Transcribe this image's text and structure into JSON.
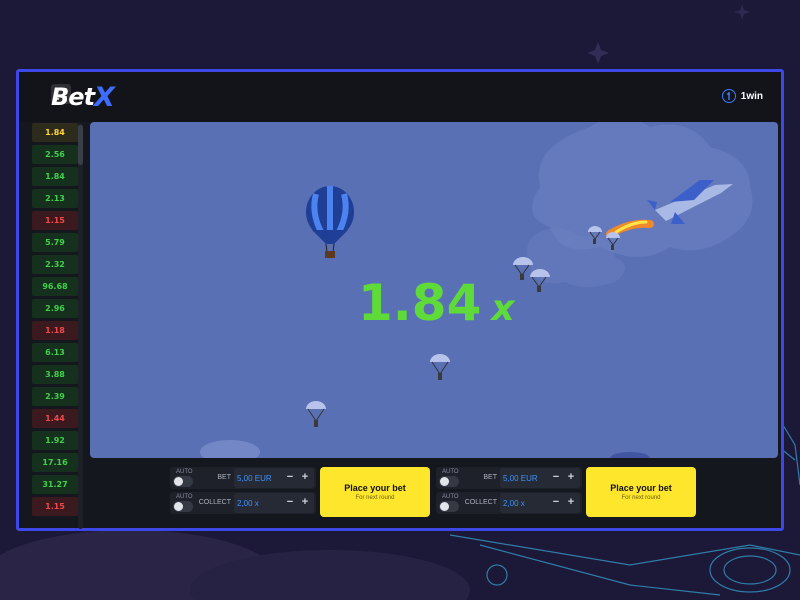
{
  "header": {
    "logo_main": "Bet",
    "logo_accent": "X",
    "brand": "1win",
    "fullscreen_icon": "fullscreen-icon",
    "brand_icon": "1win-coin-icon"
  },
  "history": [
    {
      "value": "1.84",
      "tone": "gold"
    },
    {
      "value": "2.56",
      "tone": "green"
    },
    {
      "value": "1.84",
      "tone": "green"
    },
    {
      "value": "2.13",
      "tone": "green"
    },
    {
      "value": "1.15",
      "tone": "red"
    },
    {
      "value": "5.79",
      "tone": "green"
    },
    {
      "value": "2.32",
      "tone": "green"
    },
    {
      "value": "96.68",
      "tone": "green"
    },
    {
      "value": "2.96",
      "tone": "green"
    },
    {
      "value": "1.18",
      "tone": "red"
    },
    {
      "value": "6.13",
      "tone": "green"
    },
    {
      "value": "3.88",
      "tone": "green"
    },
    {
      "value": "2.39",
      "tone": "green"
    },
    {
      "value": "1.44",
      "tone": "red"
    },
    {
      "value": "1.92",
      "tone": "green"
    },
    {
      "value": "17.16",
      "tone": "green"
    },
    {
      "value": "31.27",
      "tone": "green"
    },
    {
      "value": "1.15",
      "tone": "red"
    }
  ],
  "game": {
    "multiplier": "1.84",
    "multiplier_suffix": "x"
  },
  "colors": {
    "accent": "#3d48e6",
    "multiplier": "#5fdb39",
    "bet_button": "#fde62c",
    "sky": "#5a70b5"
  },
  "bet_panels": [
    {
      "auto_label_1": "AUTO",
      "auto_label_2": "AUTO",
      "bet_label": "BET",
      "bet_value": "5,00 EUR",
      "collect_label": "COLLECT",
      "collect_value": "2,00 x",
      "button_title": "Place your bet",
      "button_subtitle": "For next round"
    },
    {
      "auto_label_1": "AUTO",
      "auto_label_2": "AUTO",
      "bet_label": "BET",
      "bet_value": "5,00 EUR",
      "collect_label": "COLLECT",
      "collect_value": "2,00 x",
      "button_title": "Place your bet",
      "button_subtitle": "For next round"
    }
  ]
}
